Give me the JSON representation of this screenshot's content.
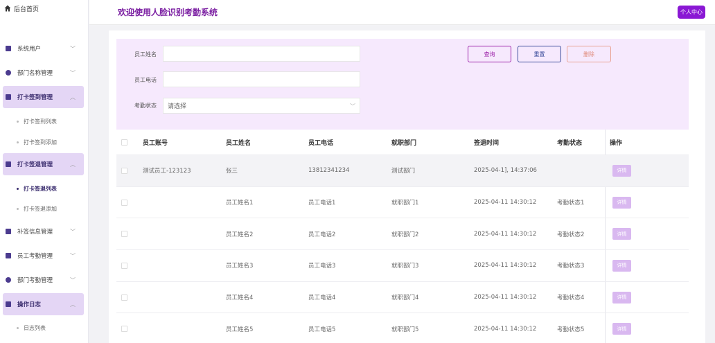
{
  "sidebar": {
    "home": "后台首页",
    "menus": [
      {
        "label": "系统用户",
        "expanded": false,
        "active": false
      },
      {
        "label": "部门名称管理",
        "expanded": false,
        "active": false
      },
      {
        "label": "打卡签到管理",
        "expanded": true,
        "active": true,
        "subs": [
          "打卡签到列表",
          "打卡签到添加"
        ]
      },
      {
        "label": "打卡签退管理",
        "expanded": true,
        "active": true,
        "subs": [
          "打卡签退列表",
          "打卡签退添加"
        ]
      },
      {
        "label": "补签信息管理",
        "expanded": false,
        "active": false
      },
      {
        "label": "员工考勤管理",
        "expanded": false,
        "active": false
      },
      {
        "label": "部门考勤管理",
        "expanded": false,
        "active": false
      },
      {
        "label": "操作日志",
        "expanded": true,
        "active": true,
        "subs": [
          "日志列表"
        ]
      }
    ],
    "active_sub": "打卡签退列表"
  },
  "header": {
    "title": "欢迎使用人脸识别考勤系统",
    "profile_button": "个人中心"
  },
  "filter": {
    "name_label": "员工姓名",
    "name_value": "",
    "phone_label": "员工电话",
    "phone_value": "",
    "status_label": "考勤状态",
    "status_placeholder": "请选择",
    "query_button": "查询",
    "reset_button": "重置",
    "delete_button": "删除"
  },
  "table": {
    "columns": [
      "员工账号",
      "员工姓名",
      "员工电话",
      "就职部门",
      "签退时间",
      "考勤状态",
      "操作"
    ],
    "detail_label": "详情",
    "rows": [
      {
        "account": "测试员工-123123",
        "name": "张三",
        "phone": "13812341234",
        "dept": "测试部门",
        "time": "2025-04-1], 14:37:06",
        "status": ""
      },
      {
        "account": "",
        "name": "员工姓名1",
        "phone": "员工电话1",
        "dept": "就职部门1",
        "time": "2025-04-11 14:30:12",
        "status": "考勤状态1"
      },
      {
        "account": "",
        "name": "员工姓名2",
        "phone": "员工电话2",
        "dept": "就职部门2",
        "time": "2025-04-11 14:30:12",
        "status": "考勤状态2"
      },
      {
        "account": "",
        "name": "员工姓名3",
        "phone": "员工电话3",
        "dept": "就职部门3",
        "time": "2025-04-11 14:30:12",
        "status": "考勤状态3"
      },
      {
        "account": "",
        "name": "员工姓名4",
        "phone": "员工电话4",
        "dept": "就职部门4",
        "time": "2025-04-11 14:30:12",
        "status": "考勤状态4"
      },
      {
        "account": "",
        "name": "员工姓名5",
        "phone": "员工电话5",
        "dept": "就职部门5",
        "time": "2025-04-11 14:30:12",
        "status": "考勤状态5"
      }
    ]
  },
  "colors": {
    "accent": "#7b1fa2",
    "menu_active_bg": "#e4d6f5",
    "filter_bg": "#f6e9fd",
    "profile_button_bg": "#8a18d4",
    "detail_button_bg": "#d9b8f0"
  }
}
